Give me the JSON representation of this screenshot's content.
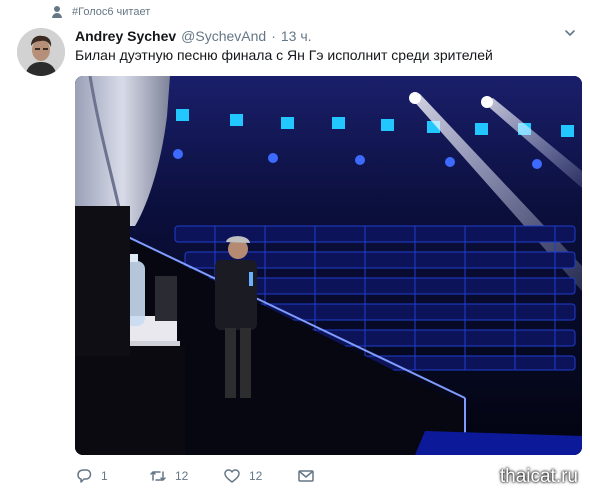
{
  "context": {
    "text": "#Голос6 читает",
    "icon": "person-icon"
  },
  "tweet": {
    "author_name": "Andrey Sychev",
    "author_handle": "@SychevAnd",
    "separator": "·",
    "time": "13 ч.",
    "text": "Билан дуэтную песню финала с Ян Гэ исполнит среди зрителей",
    "media": {
      "description_icon": "photo-stage-image"
    }
  },
  "actions": {
    "reply_count": "1",
    "retweet_count": "12",
    "like_count": "12"
  },
  "watermark": "thaicat.ru",
  "colors": {
    "secondary": "#657786",
    "text": "#14171a",
    "stage_blue": "#1f4cff"
  }
}
